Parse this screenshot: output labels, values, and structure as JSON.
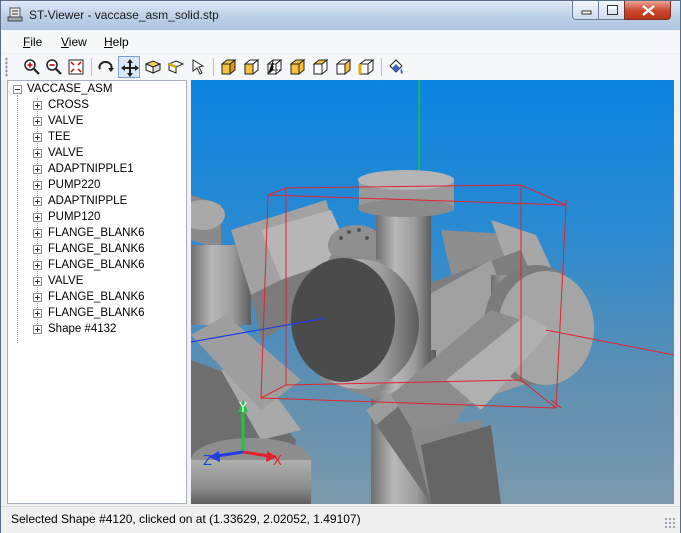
{
  "window": {
    "title": "ST-Viewer - vaccase_asm_solid.stp"
  },
  "menu": {
    "items": [
      {
        "label": "File",
        "key": "F",
        "rest": "ile"
      },
      {
        "label": "View",
        "key": "V",
        "rest": "iew"
      },
      {
        "label": "Help",
        "key": "H",
        "rest": "elp"
      }
    ]
  },
  "toolbar": {
    "buttons": [
      "zoom-in-icon",
      "zoom-out-icon",
      "zoom-fit-icon",
      "rotate-icon",
      "pan-icon",
      "select-face-icon",
      "select-edge-icon",
      "select-pointer-icon",
      "view-iso-icon",
      "view-front-icon",
      "view-back-icon",
      "view-top-icon",
      "view-bottom-icon",
      "view-left-icon",
      "view-right-icon",
      "fill-mode-icon"
    ],
    "active": "pan-icon"
  },
  "tree": {
    "root": "VACCASE_ASM",
    "children": [
      "CROSS",
      "VALVE",
      "TEE",
      "VALVE",
      "ADAPTNIPPLE1",
      "PUMP220",
      "ADAPTNIPPLE",
      "PUMP120",
      "FLANGE_BLANK6",
      "FLANGE_BLANK6",
      "FLANGE_BLANK6",
      "VALVE",
      "FLANGE_BLANK6",
      "FLANGE_BLANK6",
      "Shape #4132"
    ]
  },
  "viewport": {
    "axis_x_label": "X",
    "axis_y_label": "Y",
    "axis_z_label": "Z",
    "colors": {
      "selection_box": "#e0242b",
      "axis_x": "#e0242b",
      "axis_y": "#22c43a",
      "axis_z": "#2040e0",
      "solid": "#a4a4a4"
    }
  },
  "status": {
    "text": "Selected Shape #4120, clicked on at (1.33629, 2.02052, 1.49107)"
  }
}
